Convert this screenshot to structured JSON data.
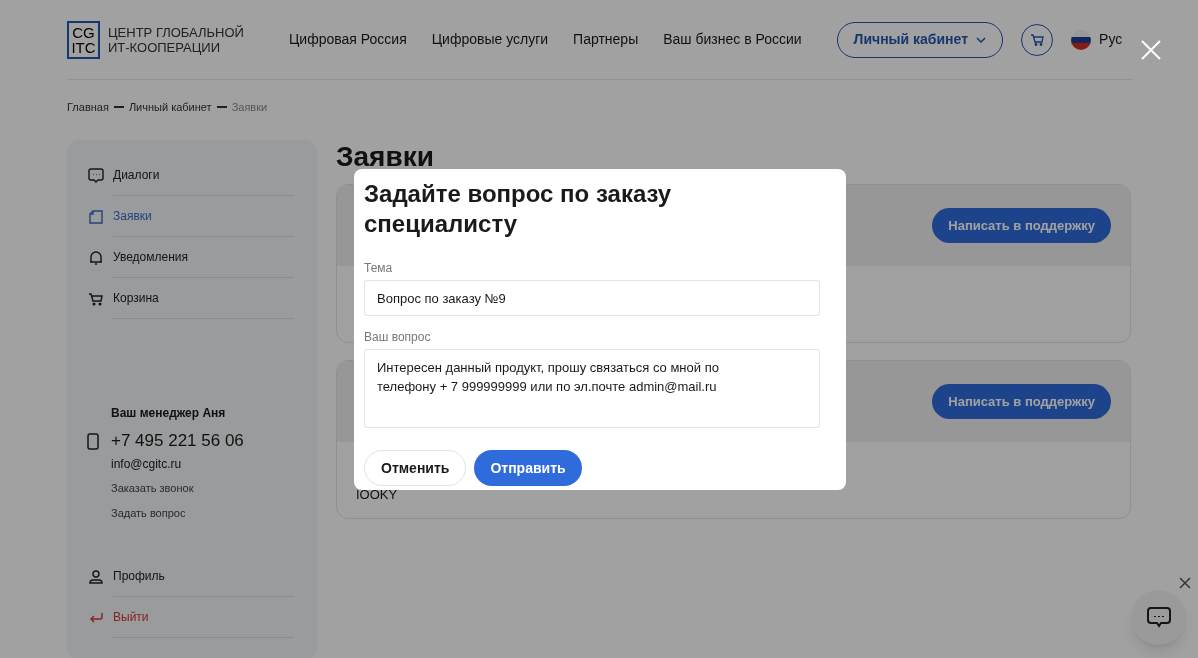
{
  "header": {
    "logo_mark": [
      "CG",
      "ITC"
    ],
    "logo_text": [
      "ЦЕНТР ГЛОБАЛЬНОЙ",
      "ИТ-КООПЕРАЦИИ"
    ],
    "nav": [
      "Цифровая Россия",
      "Цифровые услуги",
      "Партнеры",
      "Ваш бизнес в России"
    ],
    "account_button": "Личный кабинет",
    "language": "Рус"
  },
  "breadcrumb": [
    {
      "label": "Главная",
      "current": false
    },
    {
      "label": "Личный кабинет",
      "current": false
    },
    {
      "label": "Заявки",
      "current": true
    }
  ],
  "sidebar": {
    "items": [
      {
        "kind": "dialogs",
        "label": "Диалоги",
        "selected": false
      },
      {
        "kind": "orders",
        "label": "Заявки",
        "selected": true
      },
      {
        "kind": "notifications",
        "label": "Уведомления",
        "selected": false
      },
      {
        "kind": "cart",
        "label": "Корзина",
        "selected": false
      }
    ],
    "manager": {
      "title": "Ваш менеджер Аня",
      "phone": "+7 495 221 56 06",
      "email": "info@cgitc.ru",
      "links": [
        "Заказать звонок",
        "Задать вопрос"
      ]
    },
    "bottom_items": [
      {
        "kind": "profile",
        "label": "Профиль"
      },
      {
        "kind": "logout",
        "label": "Выйти"
      }
    ]
  },
  "page_title": "Заявки",
  "orders": [
    {
      "button": "Написать в поддержку"
    },
    {
      "button": "Написать в поддержку",
      "text": "IOOKY"
    }
  ],
  "modal": {
    "title": "Задайте вопрос по заказу специалисту",
    "fields": [
      {
        "kind": "input",
        "label": "Тема",
        "value": "Вопрос по заказу №9"
      },
      {
        "kind": "textarea",
        "label": "Ваш вопрос",
        "value": "Интересен данный продукт, прошу связаться со мной по телефону + 7 999999999 или по эл.почте admin@mail.ru"
      }
    ],
    "cancel_button": "Отменить",
    "submit_button": "Отправить"
  }
}
